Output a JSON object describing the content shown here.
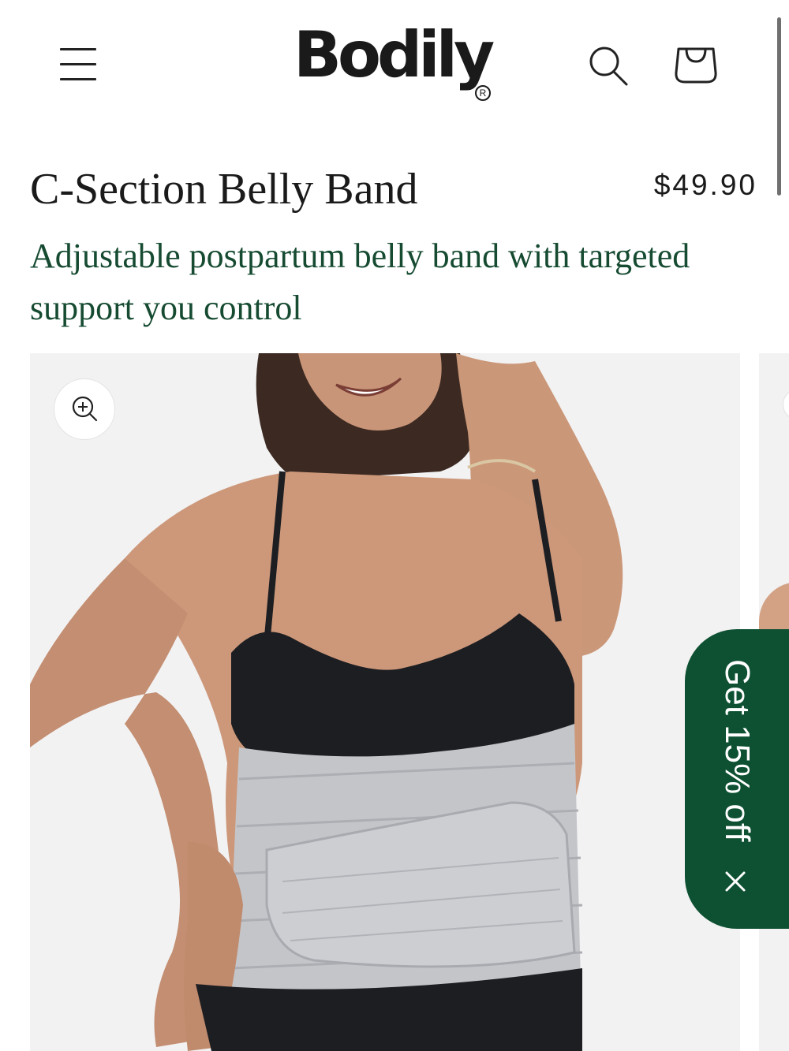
{
  "header": {
    "brand_name": "Bodily",
    "brand_mark": "R",
    "icons": {
      "menu": "hamburger-menu-icon",
      "search": "search-icon",
      "cart": "shopping-bag-icon"
    }
  },
  "product": {
    "title": "C-Section Belly Band",
    "price": "$49.90",
    "subtitle": "Adjustable postpartum belly band with targeted support you control"
  },
  "gallery": {
    "zoom_icon": "zoom-in-icon"
  },
  "promo": {
    "label": "Get 15% off",
    "close_icon": "close-icon",
    "color": "#0e5132"
  },
  "colors": {
    "accent_green": "#164b32",
    "text_dark": "#1a1a1a",
    "gallery_bg": "#f2f2f3"
  }
}
